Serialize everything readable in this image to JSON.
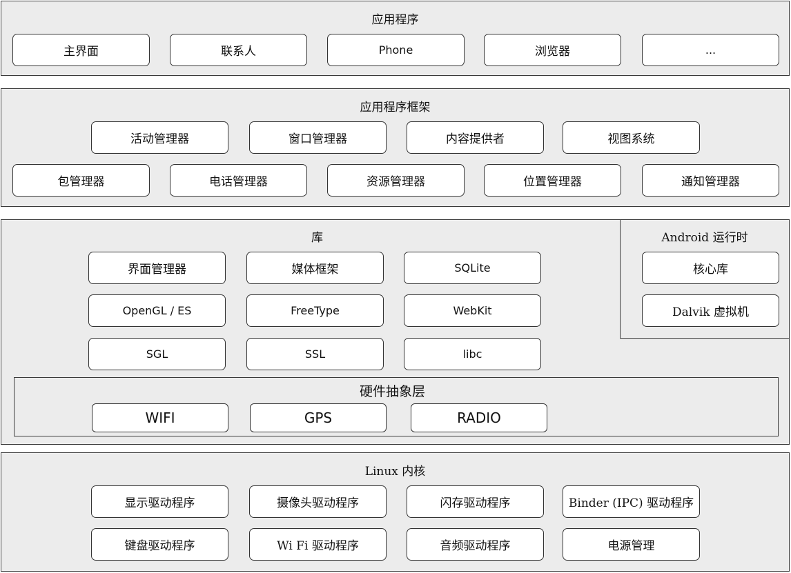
{
  "applications": {
    "title": "应用程序",
    "items": [
      "主界面",
      "联系人",
      "Phone",
      "浏览器",
      "..."
    ]
  },
  "framework": {
    "title": "应用程序框架",
    "row1": [
      "活动管理器",
      "窗口管理器",
      "内容提供者",
      "视图系统"
    ],
    "row2": [
      "包管理器",
      "电话管理器",
      "资源管理器",
      "位置管理器",
      "通知管理器"
    ]
  },
  "libraries": {
    "title": "库",
    "items": [
      "界面管理器",
      "媒体框架",
      "SQLite",
      "OpenGL / ES",
      "FreeType",
      "WebKit",
      "SGL",
      "SSL",
      "libc"
    ]
  },
  "runtime": {
    "title": "Android 运行时",
    "items": [
      "核心库",
      "Dalvik 虚拟机"
    ]
  },
  "hal": {
    "title": "硬件抽象层",
    "items": [
      "WIFI",
      "GPS",
      "RADIO"
    ]
  },
  "kernel": {
    "title": "Linux 内核",
    "row1": [
      "显示驱动程序",
      "摄像头驱动程序",
      "闪存驱动程序",
      "Binder (IPC) 驱动程序"
    ],
    "row2": [
      "键盘驱动程序",
      "Wi Fi 驱动程序",
      "音频驱动程序",
      "电源管理"
    ]
  }
}
